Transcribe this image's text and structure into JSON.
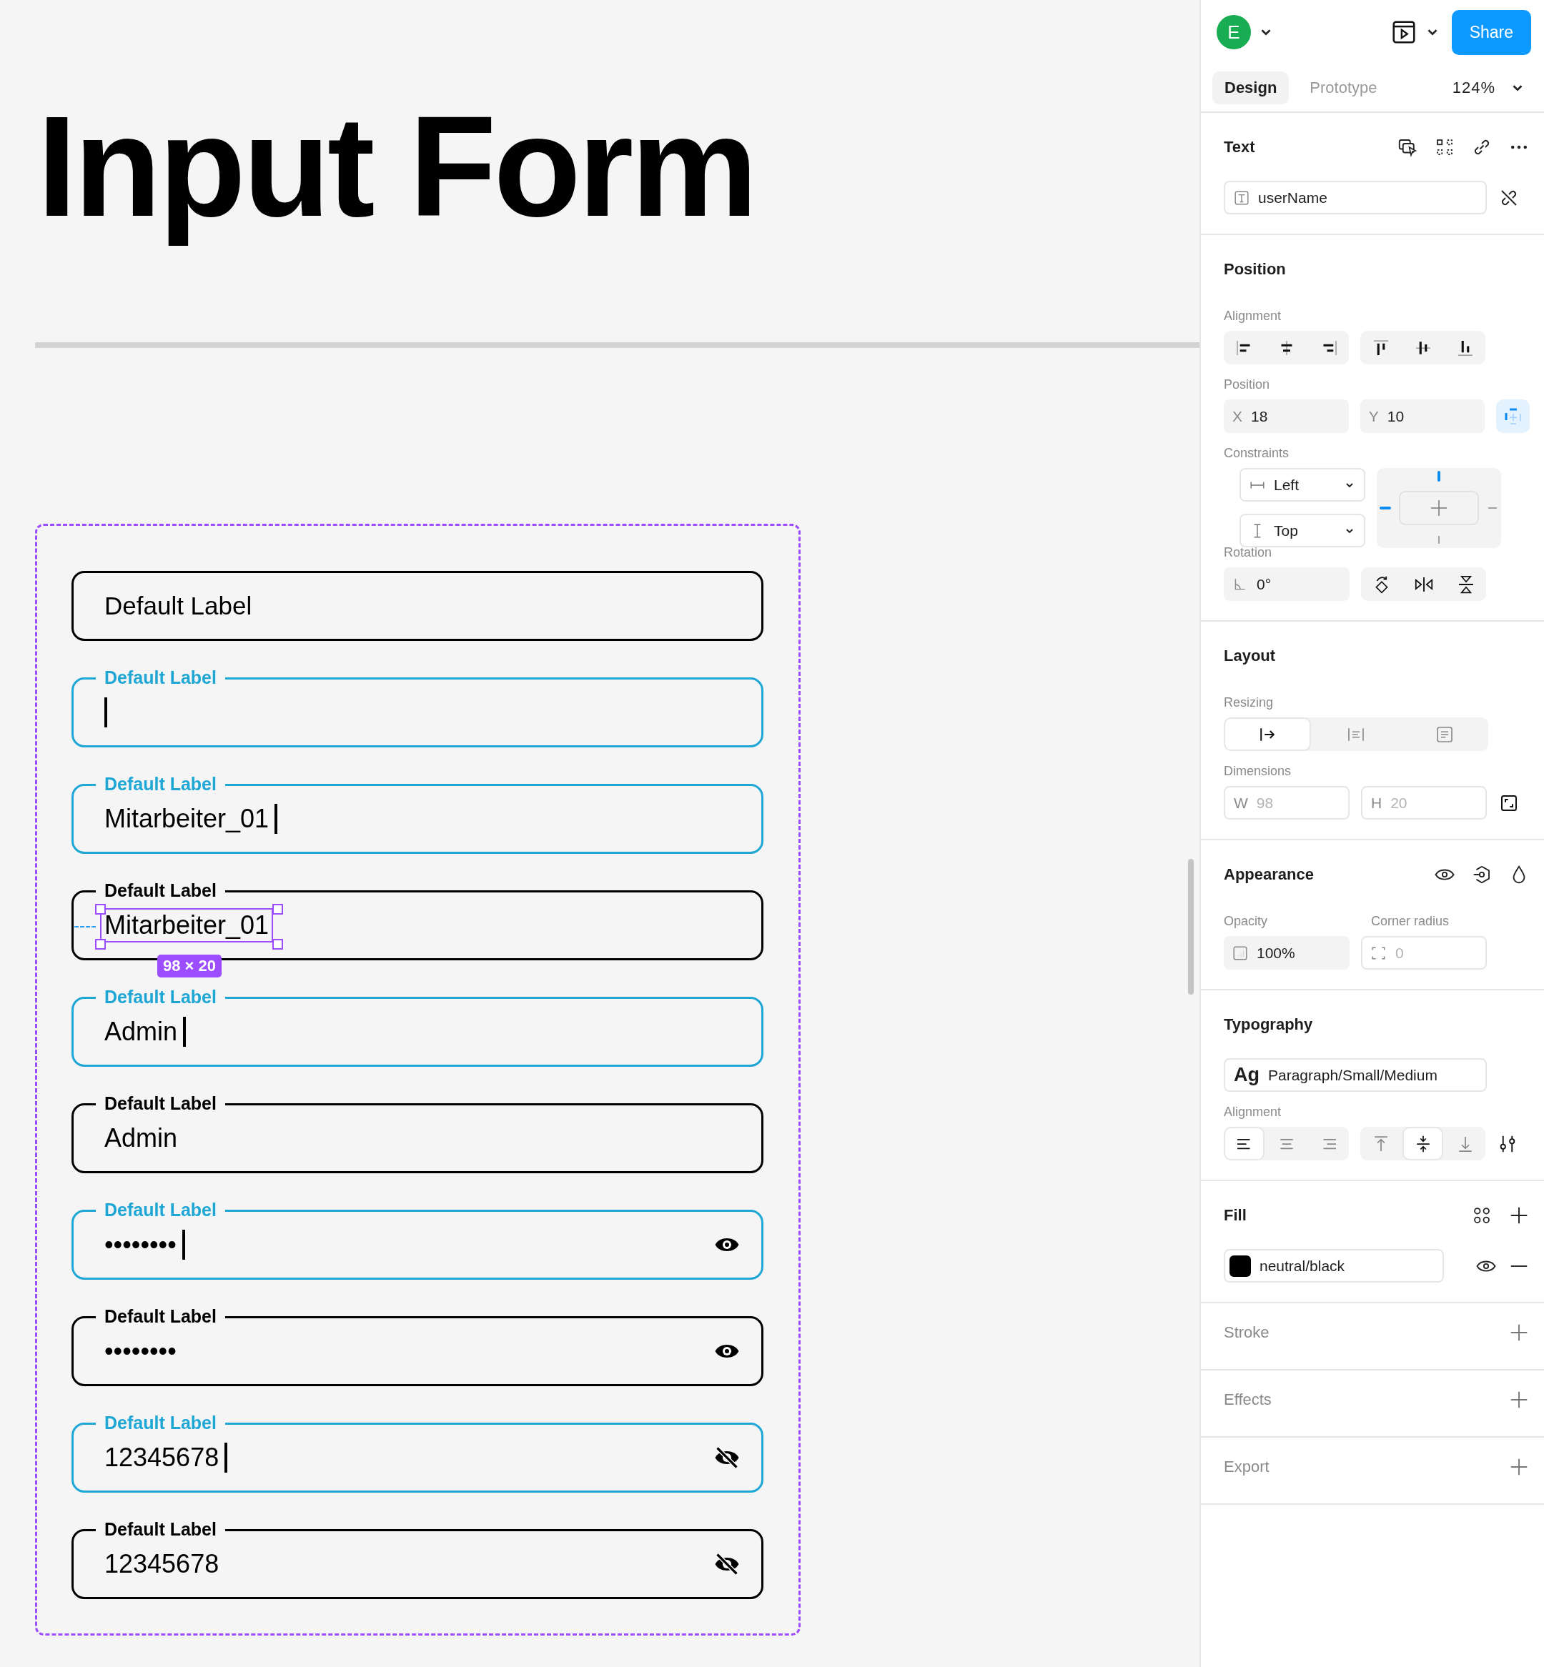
{
  "canvas": {
    "title": "Input Form",
    "fields": [
      {
        "label": "Default Label",
        "kind": "text",
        "focused": false,
        "selected": false
      },
      {
        "label": "Default Label",
        "kind": "text",
        "focused": true,
        "selected": false
      },
      {
        "label": "Default Label",
        "value": "Mitarbeiter_01",
        "kind": "text",
        "focused": true,
        "selected": false
      },
      {
        "label": "Default Label",
        "value": "Mitarbeiter_01",
        "kind": "text",
        "focused": false,
        "selected": true,
        "size_badge": "98 × 20"
      },
      {
        "label": "Default Label",
        "value": "Admin",
        "kind": "text",
        "focused": true,
        "selected": false
      },
      {
        "label": "Default Label",
        "value": "Admin",
        "kind": "text",
        "focused": false,
        "selected": false
      },
      {
        "label": "Default Label",
        "value": "••••••••",
        "kind": "password_hidden",
        "focused": true,
        "selected": false
      },
      {
        "label": "Default Label",
        "value": "••••••••",
        "kind": "password_hidden",
        "focused": false,
        "selected": false
      },
      {
        "label": "Default Label",
        "value": "12345678",
        "kind": "password_shown",
        "focused": true,
        "selected": false
      },
      {
        "label": "Default Label",
        "value": "12345678",
        "kind": "password_shown",
        "focused": false,
        "selected": false
      }
    ]
  },
  "panel": {
    "avatar": "E",
    "share": "Share",
    "tabs": [
      {
        "label": "Design",
        "selected": true
      },
      {
        "label": "Prototype",
        "selected": false
      }
    ],
    "zoom": "124%",
    "text": {
      "title": "Text",
      "layer_name": "userName"
    },
    "position": {
      "title": "Position",
      "alignment_label": "Alignment",
      "position_label": "Position",
      "x": {
        "label": "X",
        "value": "18"
      },
      "y": {
        "label": "Y",
        "value": "10"
      },
      "constraints_label": "Constraints",
      "horizontal": "Left",
      "vertical": "Top",
      "rotation_label": "Rotation",
      "rotation": "0°"
    },
    "layout": {
      "title": "Layout",
      "resizing_label": "Resizing",
      "resizing": [
        {
          "selected": true
        },
        {
          "selected": false
        },
        {
          "selected": false
        }
      ],
      "dimensions_label": "Dimensions",
      "w": {
        "label": "W",
        "value": "98",
        "disabled": true
      },
      "h": {
        "label": "H",
        "value": "20",
        "disabled": true
      }
    },
    "appearance": {
      "title": "Appearance",
      "opacity_label": "Opacity",
      "opacity": "100%",
      "radius_label": "Corner radius",
      "radius": "0",
      "radius_disabled": true
    },
    "typography": {
      "title": "Typography",
      "sample": "Ag",
      "style": "Paragraph/Small/Medium",
      "alignment_label": "Alignment",
      "horizontal": [
        {
          "selected": true
        },
        {
          "selected": false
        },
        {
          "selected": false
        }
      ],
      "vertical": [
        {
          "selected": false
        },
        {
          "selected": true
        },
        {
          "selected": false
        }
      ]
    },
    "fill": {
      "title": "Fill",
      "color": "#000000",
      "name": "neutral/black"
    },
    "sections": [
      {
        "title": "Stroke"
      },
      {
        "title": "Effects"
      },
      {
        "title": "Export"
      }
    ]
  }
}
